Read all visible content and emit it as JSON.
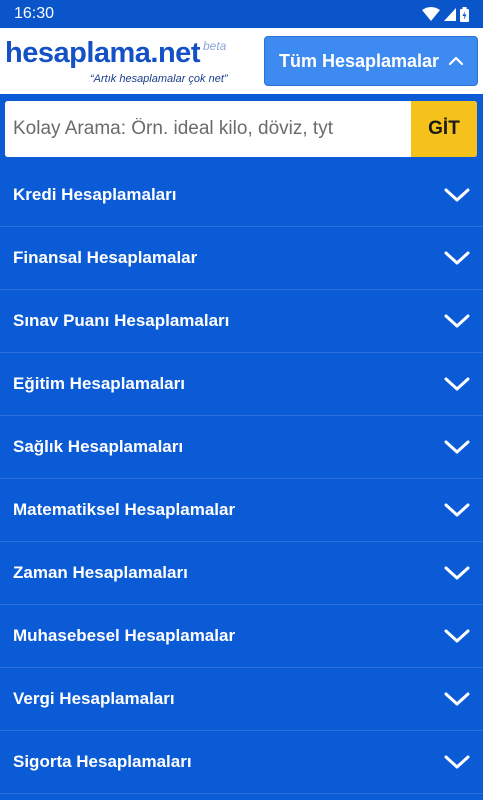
{
  "status_bar": {
    "time": "16:30"
  },
  "header": {
    "logo_text": "hesaplama.net",
    "logo_beta": "beta",
    "logo_slogan": "“Artık hesaplamalar çok net”",
    "all_button_label": "Tüm Hesaplamalar",
    "all_button_icon": "chevron-up-icon"
  },
  "search": {
    "placeholder": "Kolay Arama: Örn. ideal kilo, döviz, tyt",
    "go_label": "GİT"
  },
  "colors": {
    "primary_blue": "#0c5bd6",
    "button_blue": "#3d8af0",
    "go_yellow": "#f5c21b",
    "logo_blue": "#1450c6"
  },
  "categories": [
    {
      "label": "Kredi Hesaplamaları",
      "icon": "chevron-down-icon"
    },
    {
      "label": "Finansal Hesaplamalar",
      "icon": "chevron-down-icon"
    },
    {
      "label": "Sınav Puanı Hesaplamaları",
      "icon": "chevron-down-icon"
    },
    {
      "label": "Eğitim Hesaplamaları",
      "icon": "chevron-down-icon"
    },
    {
      "label": "Sağlık Hesaplamaları",
      "icon": "chevron-down-icon"
    },
    {
      "label": "Matematiksel Hesaplamalar",
      "icon": "chevron-down-icon"
    },
    {
      "label": "Zaman Hesaplamaları",
      "icon": "chevron-down-icon"
    },
    {
      "label": "Muhasebesel Hesaplamalar",
      "icon": "chevron-down-icon"
    },
    {
      "label": "Vergi Hesaplamaları",
      "icon": "chevron-down-icon"
    },
    {
      "label": "Sigorta Hesaplamaları",
      "icon": "chevron-down-icon"
    }
  ]
}
